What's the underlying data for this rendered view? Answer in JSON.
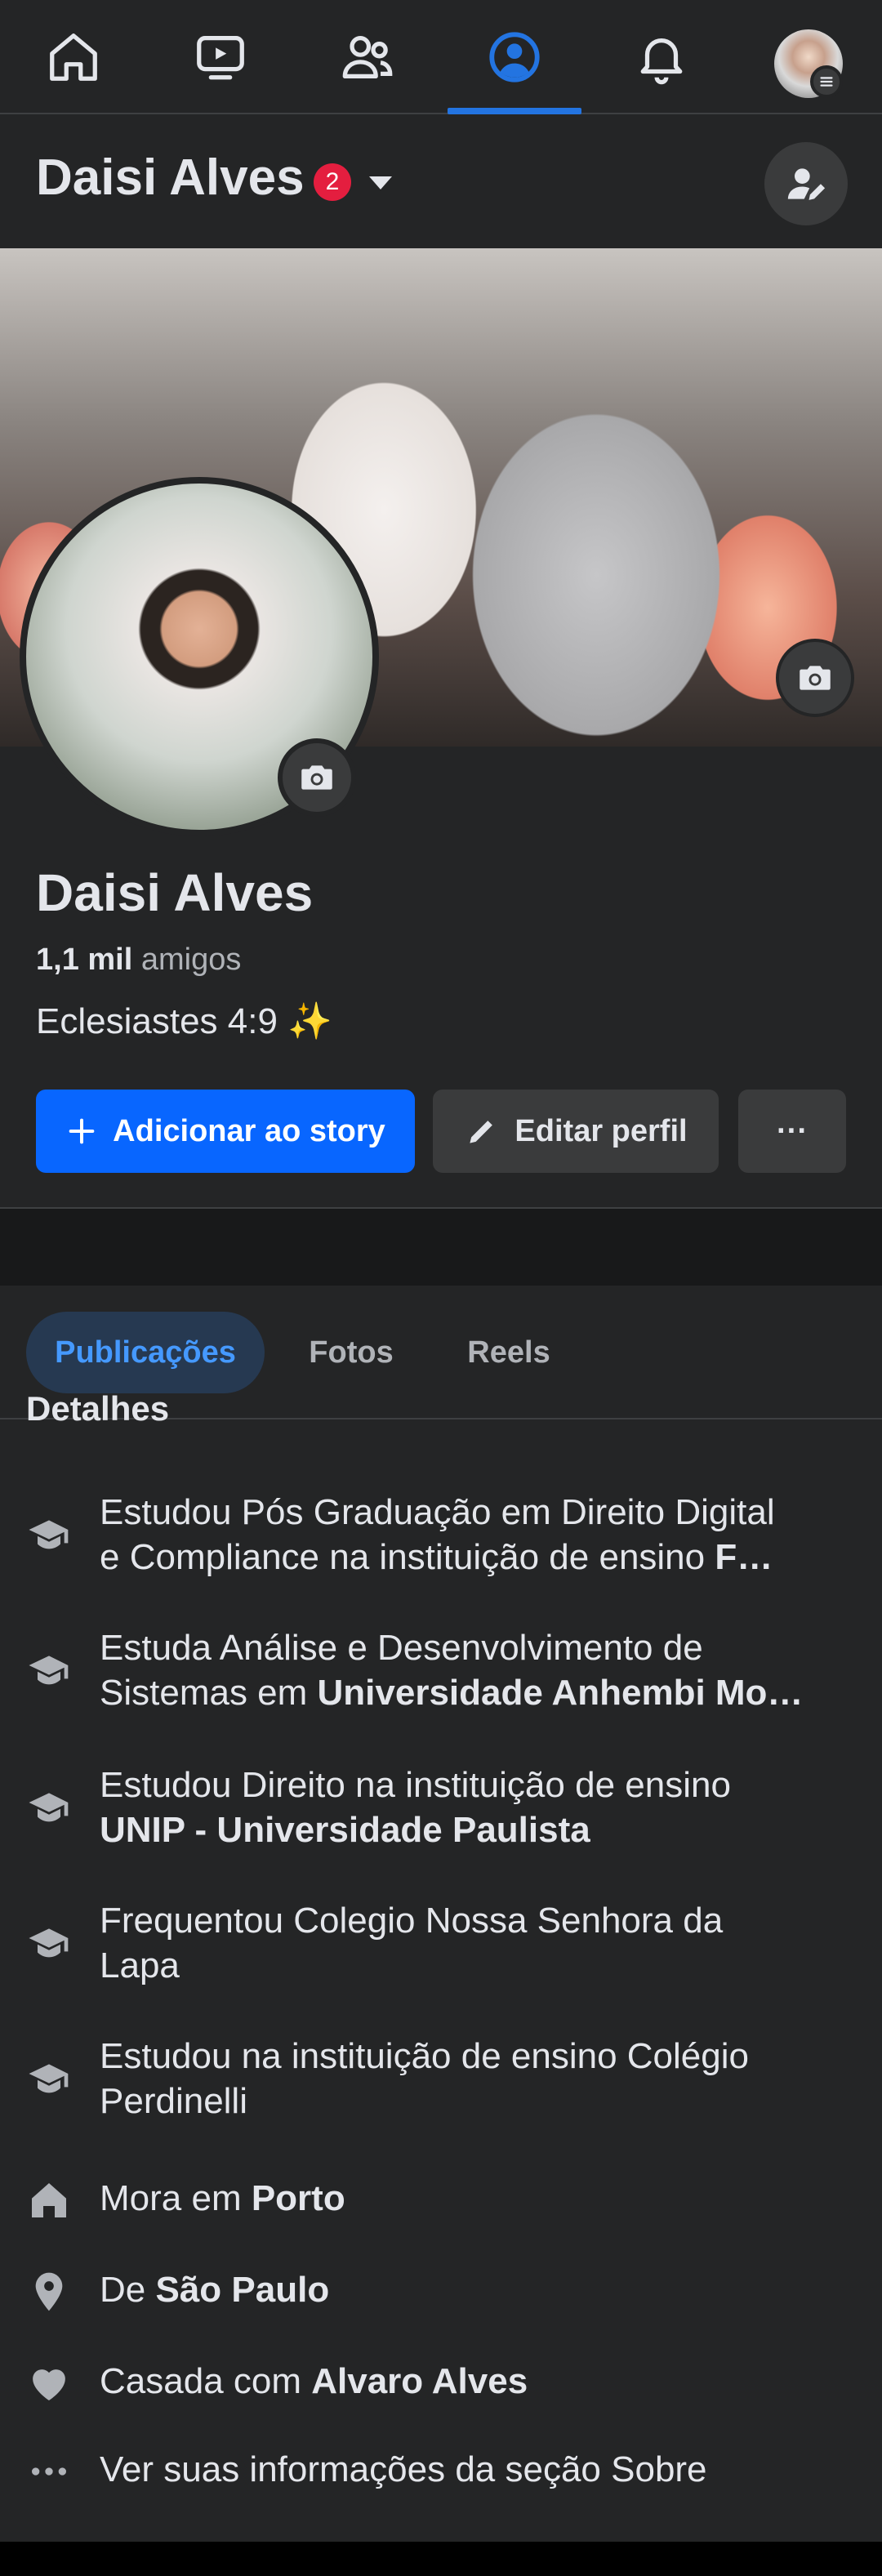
{
  "nav": {
    "items": [
      {
        "name": "home-icon"
      },
      {
        "name": "video-icon"
      },
      {
        "name": "friends-icon"
      },
      {
        "name": "profile-icon",
        "active": true
      },
      {
        "name": "bell-icon"
      },
      {
        "name": "menu-avatar"
      }
    ]
  },
  "header": {
    "name": "Daisi Alves",
    "badge": "2"
  },
  "profile": {
    "name": "Daisi Alves",
    "friends_count": "1,1 mil",
    "friends_label": "amigos",
    "bio": "Eclesiastes 4:9 ✨"
  },
  "actions": {
    "add_story": "Adicionar ao story",
    "edit_profile": "Editar perfil",
    "more": "···"
  },
  "tabs": [
    "Publicações",
    "Fotos",
    "Reels"
  ],
  "details": {
    "heading": "Detalhes",
    "items": [
      {
        "icon": "graduation-cap-icon",
        "prefix": "Estudou Pós Graduação em Direito Digital",
        "line2": "e Compliance na instituição de ensino ",
        "bold": "F…"
      },
      {
        "icon": "graduation-cap-icon",
        "prefix": "Estuda Análise e Desenvolvimento de",
        "line2": "Sistemas em ",
        "bold": "Universidade Anhembi Mo…"
      },
      {
        "icon": "graduation-cap-icon",
        "prefix": "Estudou Direito na instituição de ensino",
        "line2": "",
        "bold": "UNIP - Universidade Paulista"
      },
      {
        "icon": "graduation-cap-icon",
        "prefix": "Frequentou Colegio Nossa Senhora da",
        "line2": "Lapa",
        "bold": ""
      },
      {
        "icon": "graduation-cap-icon",
        "prefix": "Estudou na instituição de ensino Colégio",
        "line2": "Perdinelli",
        "bold": ""
      },
      {
        "icon": "home-icon",
        "prefix": "Mora em ",
        "line2": "",
        "bold": "Porto"
      },
      {
        "icon": "location-pin-icon",
        "prefix": "De ",
        "line2": "",
        "bold": "São Paulo"
      },
      {
        "icon": "heart-icon",
        "prefix": "Casada com ",
        "line2": "",
        "bold": "Alvaro Alves"
      },
      {
        "icon": "more-dots-icon",
        "prefix": "Ver suas informações da seção Sobre",
        "line2": "",
        "bold": ""
      }
    ]
  },
  "colors": {
    "background": "#242526",
    "accent": "#0866ff",
    "active_tab_bg": "#263951",
    "active_tab_text": "#4599ff",
    "badge": "#e41e3f"
  }
}
